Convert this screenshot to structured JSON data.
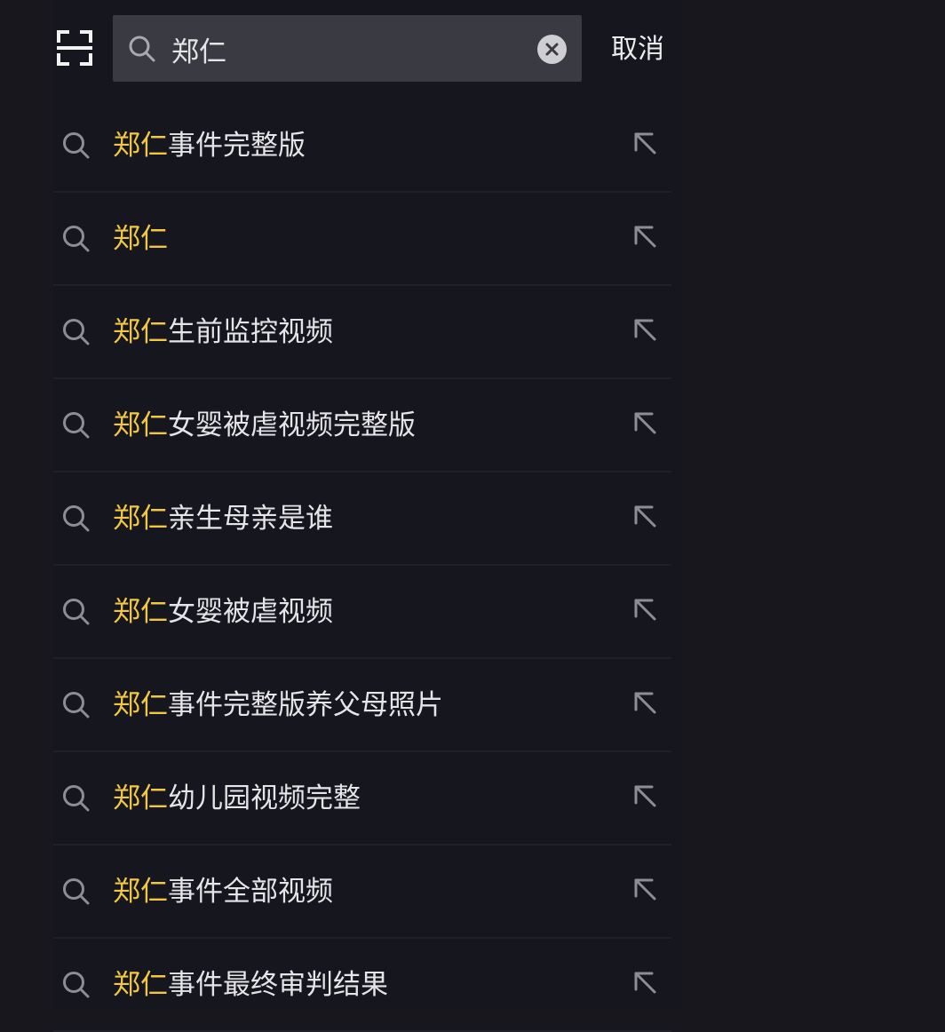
{
  "header": {
    "scan_icon": "scan-icon",
    "search": {
      "icon": "search-icon",
      "value": "郑仁",
      "clear_icon": "clear-icon"
    },
    "cancel_label": "取消"
  },
  "suggestions": [
    {
      "highlight": "郑仁",
      "rest": "事件完整版"
    },
    {
      "highlight": "郑仁",
      "rest": ""
    },
    {
      "highlight": "郑仁",
      "rest": "生前监控视频"
    },
    {
      "highlight": "郑仁",
      "rest": "女婴被虐视频完整版"
    },
    {
      "highlight": "郑仁",
      "rest": "亲生母亲是谁"
    },
    {
      "highlight": "郑仁",
      "rest": "女婴被虐视频"
    },
    {
      "highlight": "郑仁",
      "rest": "事件完整版养父母照片"
    },
    {
      "highlight": "郑仁",
      "rest": "幼儿园视频完整"
    },
    {
      "highlight": "郑仁",
      "rest": "事件全部视频"
    },
    {
      "highlight": "郑仁",
      "rest": "事件最终审判结果"
    }
  ],
  "icons": {
    "suggestion_icon": "search-icon",
    "fill_icon": "arrow-up-left-icon"
  },
  "colors": {
    "background": "#18171e",
    "search_field": "#3a3a42",
    "highlight": "#f2c744",
    "text": "#e5e5e8",
    "icon": "#8d8d94"
  }
}
